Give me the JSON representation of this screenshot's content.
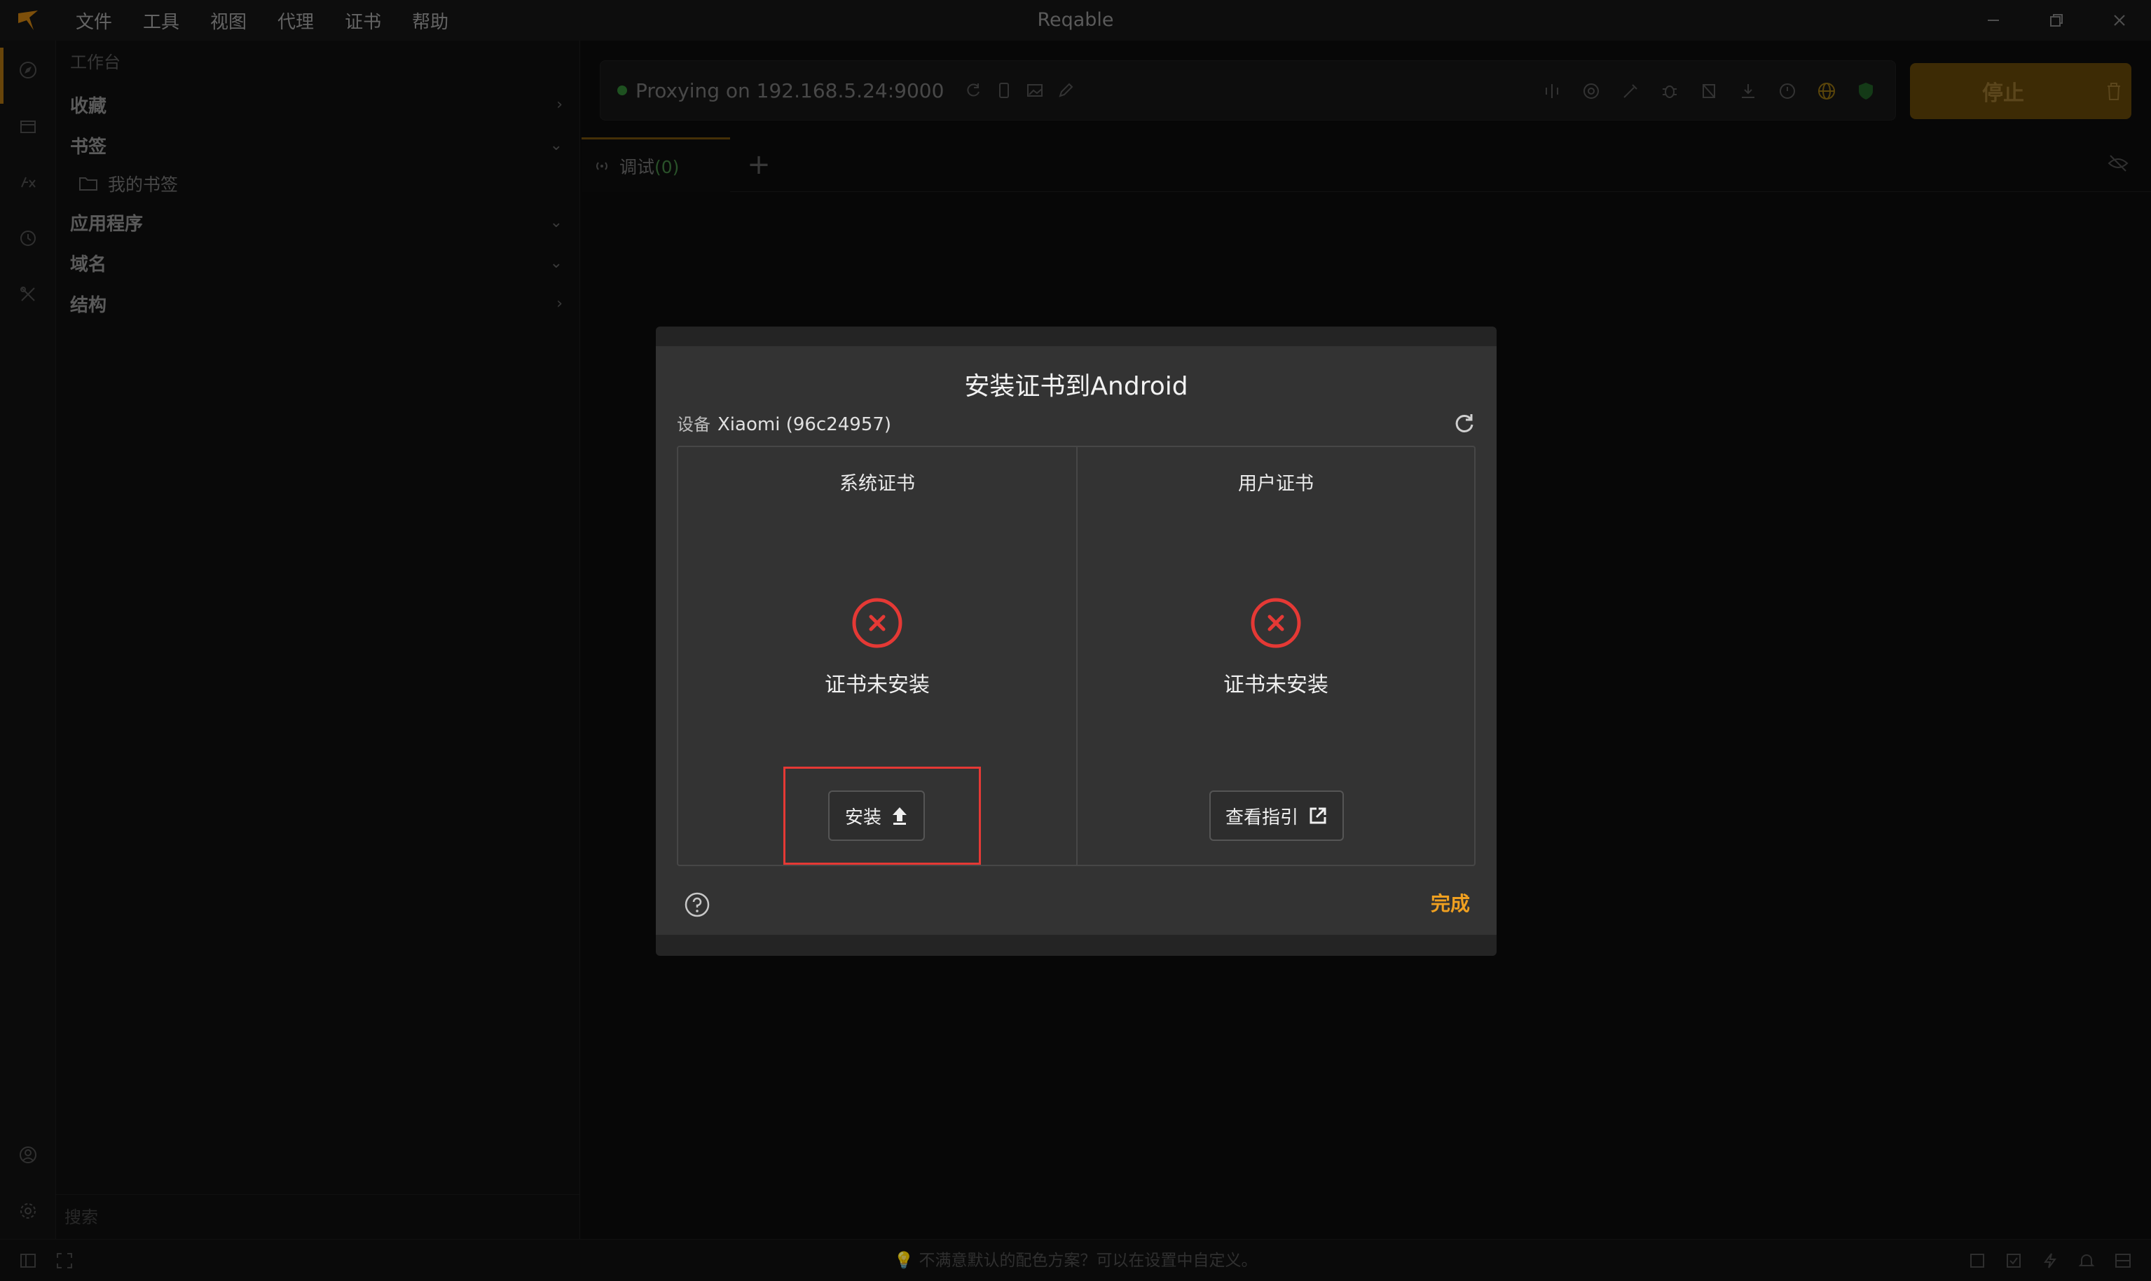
{
  "app": {
    "title": "Reqable",
    "menu": [
      "文件",
      "工具",
      "视图",
      "代理",
      "证书",
      "帮助"
    ]
  },
  "sidebar": {
    "header": "工作台",
    "items": [
      {
        "label": "收藏",
        "chevron": "›"
      },
      {
        "label": "书签",
        "chevron": "⌄"
      },
      {
        "label": "应用程序",
        "chevron": "⌄"
      },
      {
        "label": "域名",
        "chevron": "⌄"
      },
      {
        "label": "结构",
        "chevron": "›"
      }
    ],
    "bookmark_folder": "我的书签",
    "search_placeholder": "搜索"
  },
  "toolbar": {
    "proxy_status": "Proxying on 192.168.5.24:9000",
    "stop_label": "停止"
  },
  "tabs": {
    "items": [
      {
        "label": "调试",
        "count": "(0)"
      }
    ],
    "add": "+"
  },
  "statusbar": {
    "tip": "不满意默认的配色方案？可以在设置中自定义。"
  },
  "dialog": {
    "title": "安装证书到Android",
    "device_prefix": "设备",
    "device_name": "Xiaomi (96c24957)",
    "panels": [
      {
        "title": "系统证书",
        "status": "证书未安装",
        "button": "安装"
      },
      {
        "title": "用户证书",
        "status": "证书未安装",
        "button": "查看指引"
      }
    ],
    "done": "完成"
  },
  "colors": {
    "accent": "#f0a020",
    "error": "#e53935",
    "proxy_on": "#2e7d32"
  }
}
